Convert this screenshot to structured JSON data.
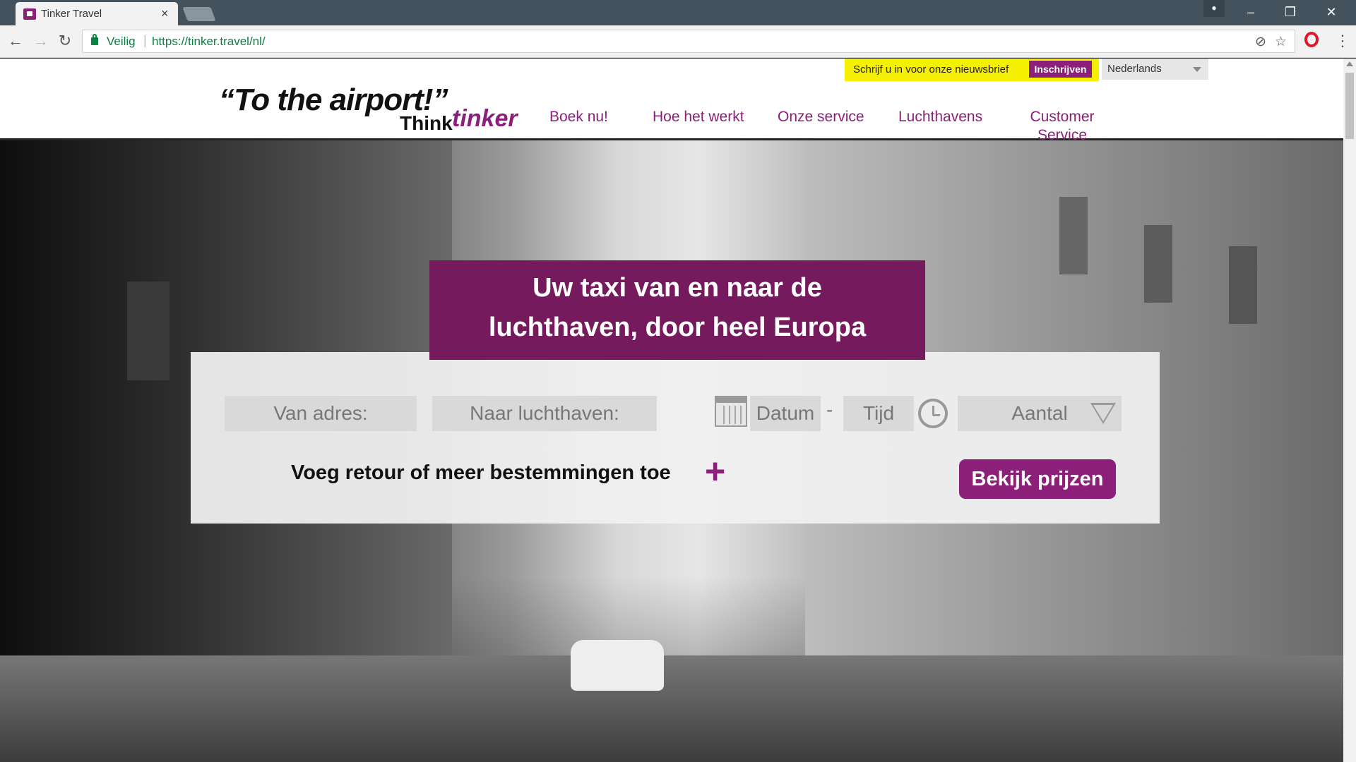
{
  "browser": {
    "tab_title": "Tinker Travel",
    "tab_close": "×",
    "secure_label": "Veilig",
    "url_separator": "|",
    "url": "https://tinker.travel/nl/",
    "window_user_icon": "user-icon",
    "window_buttons": [
      "–",
      "❐",
      "✕"
    ]
  },
  "header": {
    "newsletter_text": "Schrijf u in voor onze nieuwsbrief",
    "newsletter_button": "Inschrijven",
    "language": "Nederlands",
    "logo_quote": "“To the airport!”",
    "logo_think": "Think",
    "logo_tinker": "tinker",
    "nav": [
      {
        "label": "Boek nu!"
      },
      {
        "label": "Hoe het werkt"
      },
      {
        "label": "Onze service"
      },
      {
        "label": "Luchthavens"
      },
      {
        "label": "Customer Service"
      }
    ]
  },
  "hero": {
    "headline_line1": "Uw taxi van en naar de",
    "headline_line2": "luchthaven, door heel Europa",
    "from_placeholder": "Van adres:",
    "to_placeholder": "Naar luchthaven:",
    "date_placeholder": "Datum",
    "date_time_separator": "-",
    "time_placeholder": "Tijd",
    "passengers_placeholder": "Aantal",
    "add_return": "Voeg retour of meer bestemmingen toe",
    "add_icon": "+",
    "cta": "Bekijk prijzen"
  },
  "colors": {
    "brand_purple": "#8b1f7a",
    "headline_bg": "#761a5e",
    "newsletter_yellow": "#f5f000"
  }
}
